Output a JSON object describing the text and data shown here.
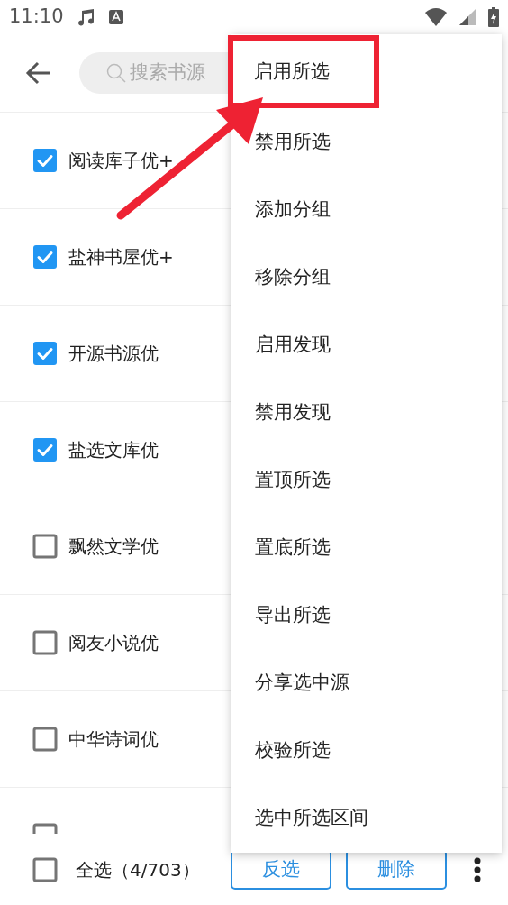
{
  "status_bar": {
    "time": "11:10"
  },
  "toolbar": {
    "search": {
      "placeholder": "搜索书源"
    }
  },
  "sources": [
    {
      "name": "阅读库子优+",
      "checked": true
    },
    {
      "name": "盐神书屋优+",
      "checked": true
    },
    {
      "name": "开源书源优",
      "checked": true
    },
    {
      "name": "盐选文库优",
      "checked": true
    },
    {
      "name": "飘然文学优",
      "checked": false
    },
    {
      "name": "阅友小说优",
      "checked": false
    },
    {
      "name": "中华诗词优",
      "checked": false
    },
    {
      "checked": false
    }
  ],
  "bottom_bar": {
    "select_all": {
      "label": "全选（4/703）",
      "checked": false
    },
    "buttons": [
      "反选",
      "删除"
    ]
  },
  "menu": {
    "items": [
      {
        "label": "启用所选",
        "highlighted": true
      },
      {
        "label": "禁用所选",
        "highlighted": false
      },
      {
        "label": "添加分组",
        "highlighted": false
      },
      {
        "label": "移除分组",
        "highlighted": false
      },
      {
        "label": "启用发现",
        "highlighted": false
      },
      {
        "label": "禁用发现",
        "highlighted": false
      },
      {
        "label": "置顶所选",
        "highlighted": false
      },
      {
        "label": "置底所选",
        "highlighted": false
      },
      {
        "label": "导出所选",
        "highlighted": false
      },
      {
        "label": "分享选中源",
        "highlighted": false
      },
      {
        "label": "校验所选",
        "highlighted": false
      },
      {
        "label": "选中所选区间",
        "highlighted": false
      }
    ]
  }
}
